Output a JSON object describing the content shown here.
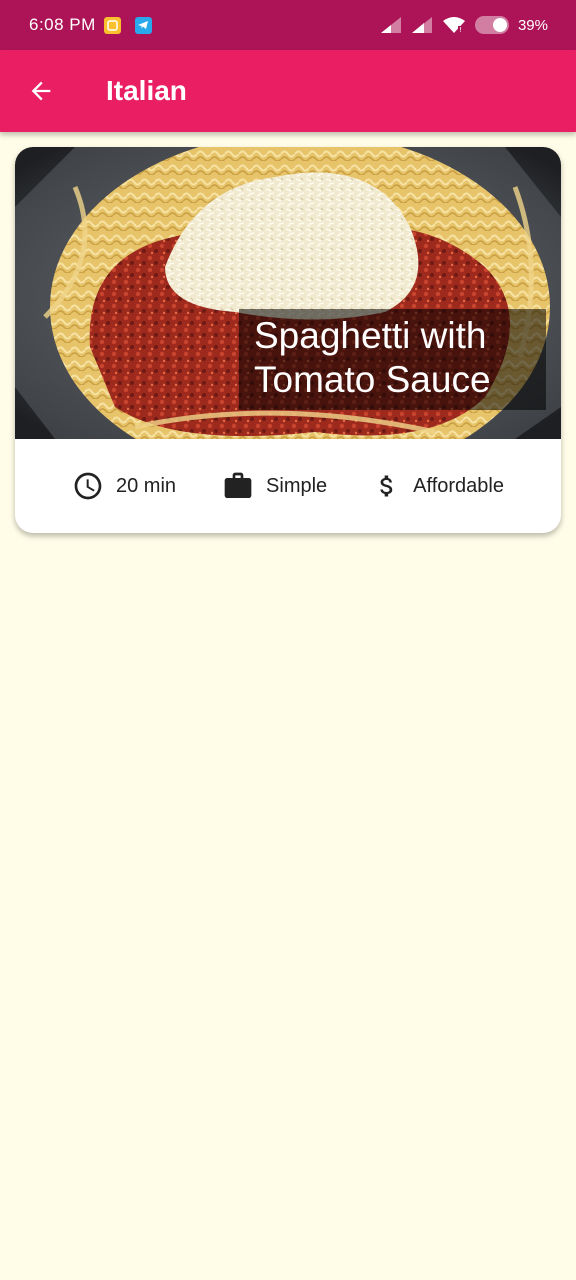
{
  "status_bar": {
    "time": "6:08 PM",
    "battery": "39%"
  },
  "app_bar": {
    "title": "Italian",
    "back_icon": "arrow-back-icon"
  },
  "meals": [
    {
      "title": "Spaghetti with Tomato Sauce",
      "duration": "20 min",
      "complexity": "Simple",
      "affordability": "Affordable",
      "icons": {
        "duration": "clock-icon",
        "complexity": "briefcase-icon",
        "affordability": "dollar-icon"
      }
    }
  ],
  "colors": {
    "status_bar": "#AD1457",
    "app_bar": "#E91E63",
    "background": "#FFFDE7",
    "card": "#FFFFFF"
  }
}
